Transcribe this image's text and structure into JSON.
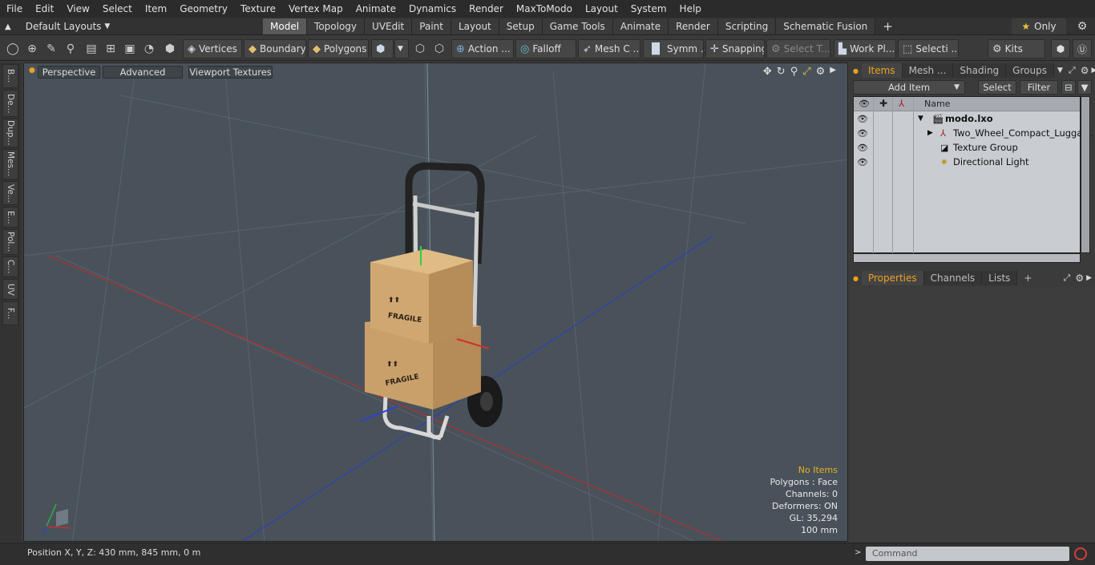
{
  "menu": [
    "File",
    "Edit",
    "View",
    "Select",
    "Item",
    "Geometry",
    "Texture",
    "Vertex Map",
    "Animate",
    "Dynamics",
    "Render",
    "MaxToModo",
    "Layout",
    "System",
    "Help"
  ],
  "layout_selector": "Default Layouts",
  "layout_tabs": [
    {
      "label": "Model",
      "active": true
    },
    {
      "label": "Topology"
    },
    {
      "label": "UVEdit"
    },
    {
      "label": "Paint"
    },
    {
      "label": "Layout"
    },
    {
      "label": "Setup"
    },
    {
      "label": "Game Tools"
    },
    {
      "label": "Animate"
    },
    {
      "label": "Render"
    },
    {
      "label": "Scripting"
    },
    {
      "label": "Schematic Fusion"
    }
  ],
  "add_tab": "+",
  "only_label": "Only",
  "toolbar": {
    "vertices": "Vertices",
    "boundary": "Boundary",
    "polygons": "Polygons",
    "action": "Action ...",
    "falloff": "Falloff",
    "mesh": "Mesh C ...",
    "symm": "Symm ...",
    "snapping": "Snapping",
    "select_t": "Select T...",
    "work_pl": "Work Pl...",
    "selecti": "Selecti ...",
    "kits": "Kits"
  },
  "left_strip": [
    "B...",
    "De...",
    "Dup...",
    "Mes...",
    "Ve...",
    "E...",
    "Pol...",
    "C...",
    "UV",
    "F..."
  ],
  "viewport": {
    "perspective": "Perspective",
    "advanced": "Advanced",
    "textures": "Viewport Textures",
    "hud": {
      "no_items": "No Items",
      "polygons": "Polygons : Face",
      "channels": "Channels: 0",
      "deformers": "Deformers: ON",
      "gl": "GL: 35,294",
      "scale": "100 mm"
    },
    "box_label": "FRAGILE"
  },
  "items_panel": {
    "tabs": [
      "Items",
      "Mesh ...",
      "Shading",
      "Groups"
    ],
    "add_item": "Add Item",
    "select": "Select",
    "filter": "Filter",
    "col_name": "Name",
    "rows": [
      {
        "name": "modo.lxo",
        "bold": true
      },
      {
        "name": "Two_Wheel_Compact_Lugga ..."
      },
      {
        "name": "Texture Group"
      },
      {
        "name": "Directional Light"
      }
    ]
  },
  "props_panel": {
    "tabs": [
      "Properties",
      "Channels",
      "Lists",
      "+"
    ]
  },
  "status": {
    "position": "Position X, Y, Z:   430 mm, 845 mm, 0 m",
    "command_placeholder": "Command"
  },
  "colors": {
    "accent": "#f0a020",
    "viewport_bg": "#49525a",
    "axis_x": "#c03030",
    "axis_z": "#3040c0"
  }
}
